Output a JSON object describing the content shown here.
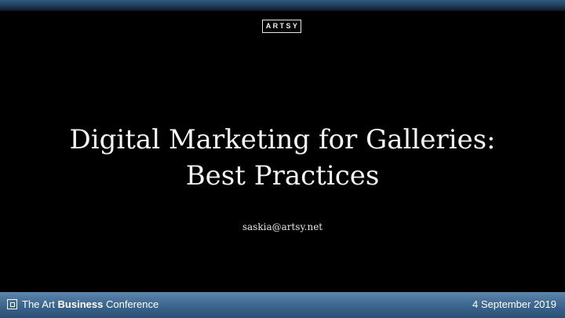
{
  "logo": {
    "text": "ARTSY"
  },
  "slide": {
    "title_line1": "Digital Marketing for Galleries:",
    "title_line2": "Best Practices",
    "email": "saskia@artsy.net"
  },
  "footer": {
    "conference_prefix": "The Art",
    "conference_strong": "Business",
    "conference_suffix": "Conference",
    "date": "4 September 2019"
  },
  "colors": {
    "background": "#000000",
    "footer_bar": "#3f6a92",
    "top_strip": "#2f5a7e",
    "text": "#f4f4f4"
  },
  "icons": {
    "footer_logo": "framed-square-icon"
  }
}
